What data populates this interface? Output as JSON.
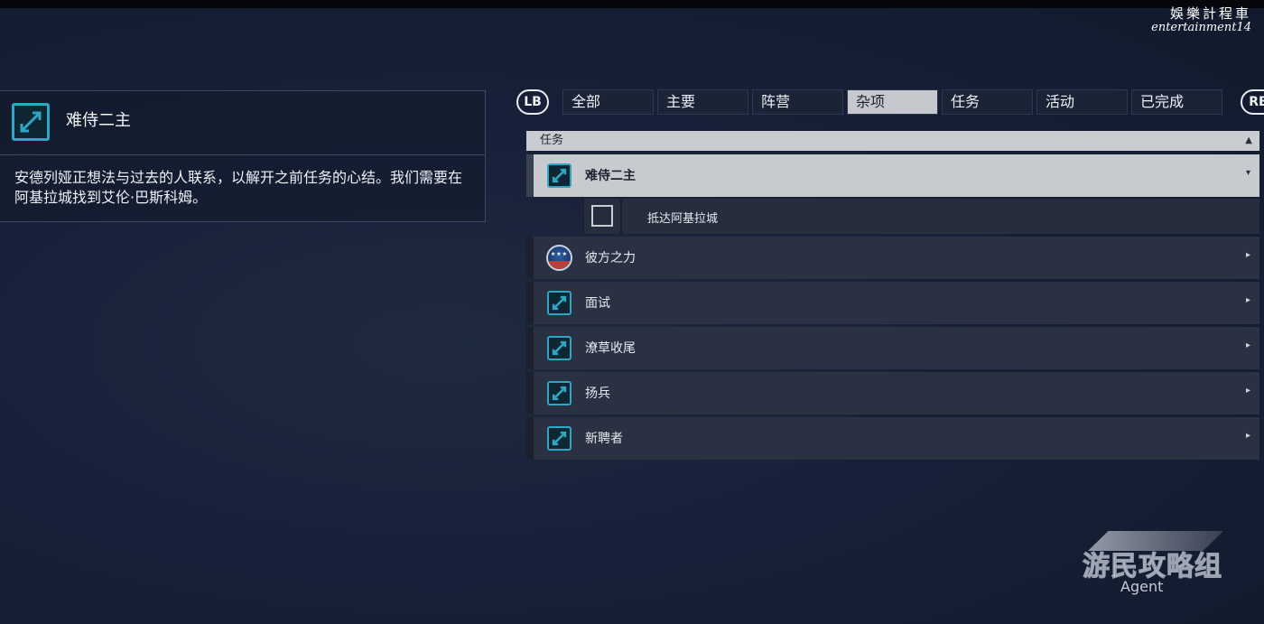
{
  "watermark_top": {
    "line1": "娛樂計程車",
    "line2": "entertainment14"
  },
  "detail": {
    "title": "难侍二主",
    "description": "安德列娅正想法与过去的人联系，以解开之前任务的心结。我们需要在阿基拉城找到艾伦·巴斯科姆。"
  },
  "buttons": {
    "lb": "LB",
    "rb": "RB"
  },
  "tabs": [
    {
      "label": "全部",
      "active": false
    },
    {
      "label": "主要",
      "active": false
    },
    {
      "label": "阵营",
      "active": false
    },
    {
      "label": "杂项",
      "active": true
    },
    {
      "label": "任务",
      "active": false
    },
    {
      "label": "活动",
      "active": false
    },
    {
      "label": "已完成",
      "active": false
    }
  ],
  "list": {
    "header": "任务",
    "sort_icon": "updown-arrows",
    "items": [
      {
        "label": "难侍二主",
        "icon": "mission-icon",
        "selected": true,
        "arrow": "▾"
      },
      {
        "label": "彼方之力",
        "icon": "faction-emblem-icon",
        "selected": false,
        "arrow": "▸"
      },
      {
        "label": "面试",
        "icon": "mission-icon",
        "selected": false,
        "arrow": "▸"
      },
      {
        "label": "潦草收尾",
        "icon": "mission-icon",
        "selected": false,
        "arrow": "▸"
      },
      {
        "label": "扬兵",
        "icon": "mission-icon",
        "selected": false,
        "arrow": "▸"
      },
      {
        "label": "新聘者",
        "icon": "mission-icon",
        "selected": false,
        "arrow": "▸"
      }
    ],
    "objective": {
      "label": "抵达阿基拉城",
      "checked": false
    }
  },
  "watermark_bottom": {
    "brand": "游民攻略组",
    "sub": "Agent"
  },
  "colors": {
    "accent": "#2fa6c6",
    "background": "#18213a",
    "active_tab": "#c5c8cd"
  }
}
